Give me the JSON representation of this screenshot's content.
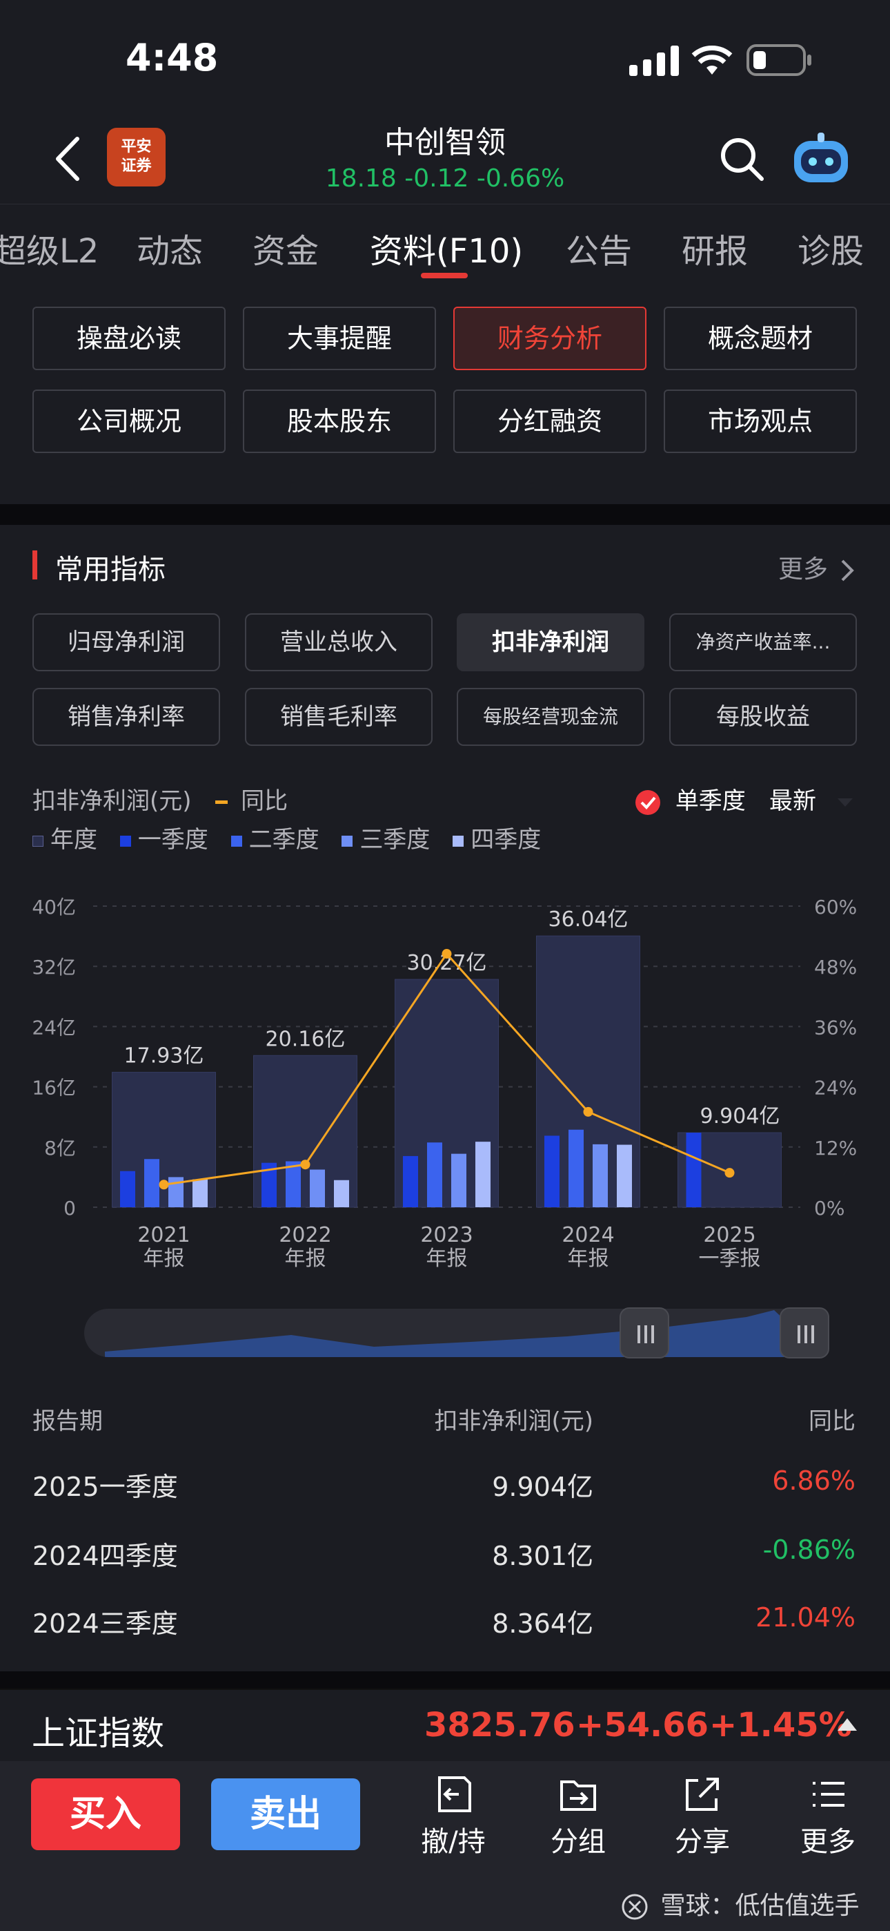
{
  "status": {
    "time": "4:48"
  },
  "header": {
    "broker_logo": "平安证券",
    "title": "中创智领",
    "quote": "18.18 -0.12 -0.66%"
  },
  "tabs": [
    {
      "label": "超级L2",
      "active": false
    },
    {
      "label": "动态",
      "active": false
    },
    {
      "label": "资金",
      "active": false
    },
    {
      "label": "资料(F10)",
      "active": true
    },
    {
      "label": "公告",
      "active": false
    },
    {
      "label": "研报",
      "active": false
    },
    {
      "label": "诊股",
      "active": false
    }
  ],
  "grid_buttons": [
    {
      "label": "操盘必读"
    },
    {
      "label": "大事提醒"
    },
    {
      "label": "财务分析",
      "active": true
    },
    {
      "label": "概念题材"
    },
    {
      "label": "公司概况"
    },
    {
      "label": "股本股东"
    },
    {
      "label": "分红融资"
    },
    {
      "label": "市场观点"
    }
  ],
  "section": {
    "title": "常用指标",
    "more": "更多"
  },
  "metrics": [
    {
      "label": "归母净利润"
    },
    {
      "label": "营业总收入"
    },
    {
      "label": "扣非净利润",
      "active": true
    },
    {
      "label": "净资产收益率..."
    },
    {
      "label": "销售净利率"
    },
    {
      "label": "销售毛利率"
    },
    {
      "label": "每股经营现金流"
    },
    {
      "label": "每股收益"
    }
  ],
  "chart_controls": {
    "series_label": "扣非净利润(元)",
    "yoy_label": "同比",
    "single_quarter": "单季度",
    "latest": "最新"
  },
  "legend": [
    "年度",
    "一季度",
    "二季度",
    "三季度",
    "四季度"
  ],
  "colors": {
    "annual": "#2a2f4d",
    "q1": "#1c3fe0",
    "q2": "#3b63ee",
    "q3": "#6f8ff5",
    "q4": "#a9bbfb",
    "yoy": "#f5a623",
    "red": "#f04438",
    "green": "#21c065"
  },
  "chart_data": {
    "type": "bar",
    "categories": [
      "2021\n年报",
      "2022\n年报",
      "2023\n年报",
      "2024\n年报",
      "2025\n一季报"
    ],
    "annual": [
      17.93,
      20.16,
      30.27,
      36.04,
      9.904
    ],
    "annual_labels": [
      "17.93亿",
      "20.16亿",
      "30.27亿",
      "36.04亿",
      "9.904亿"
    ],
    "quarters": [
      [
        4.8,
        6.4,
        4.0,
        3.7
      ],
      [
        5.9,
        6.1,
        5.0,
        3.6
      ],
      [
        6.8,
        8.6,
        7.1,
        8.7
      ],
      [
        9.5,
        10.3,
        8.36,
        8.3
      ],
      [
        9.904,
        null,
        null,
        null
      ]
    ],
    "yoy": [
      4.5,
      8.5,
      50.5,
      19.0,
      6.86
    ],
    "y_left_ticks": [
      "0",
      "8亿",
      "16亿",
      "24亿",
      "32亿",
      "40亿"
    ],
    "y_right_ticks": [
      "0%",
      "12%",
      "24%",
      "36%",
      "48%",
      "60%"
    ],
    "ylim": [
      0,
      40
    ],
    "y2lim": [
      0,
      60
    ]
  },
  "table": {
    "headers": [
      "报告期",
      "扣非净利润(元)",
      "同比"
    ],
    "rows": [
      {
        "period": "2025一季度",
        "value": "9.904亿",
        "yoy": "6.86%",
        "dir": "up"
      },
      {
        "period": "2024四季度",
        "value": "8.301亿",
        "yoy": "-0.86%",
        "dir": "down"
      },
      {
        "period": "2024三季度",
        "value": "8.364亿",
        "yoy": "21.04%",
        "dir": "up"
      }
    ]
  },
  "index": {
    "name": "上证指数",
    "value": "3825.76",
    "change": "+54.66",
    "pct": "+1.45%"
  },
  "bottom": {
    "buy": "买入",
    "sell": "卖出",
    "actions": [
      "撤/持",
      "分组",
      "分享",
      "更多"
    ]
  },
  "watermark": "雪球：低估值选手"
}
